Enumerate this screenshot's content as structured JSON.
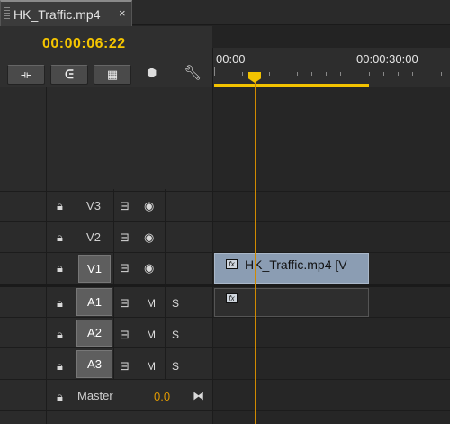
{
  "tab": {
    "title": "HK_Traffic.mp4",
    "close": "×"
  },
  "timecode": "00:00:06:22",
  "toolbar": {
    "icons": [
      "snap-icon",
      "link-icon",
      "linked-selection-icon",
      "add-marker-icon",
      "wrench-icon"
    ]
  },
  "ruler": {
    "start": "00:00",
    "end": "00:00:30:00"
  },
  "tracks": {
    "video": [
      "V3",
      "V2",
      "V1"
    ],
    "audio": [
      "A1",
      "A2",
      "A3"
    ],
    "master_label": "Master",
    "master_value": "0.0",
    "mute": "M",
    "solo": "S"
  },
  "clip": {
    "video_name": "HK_Traffic.mp4 [V",
    "fx": "fx"
  },
  "colors": {
    "timecode": "#f5c500",
    "playhead": "#d08a00",
    "clip": "#8b9db3"
  }
}
